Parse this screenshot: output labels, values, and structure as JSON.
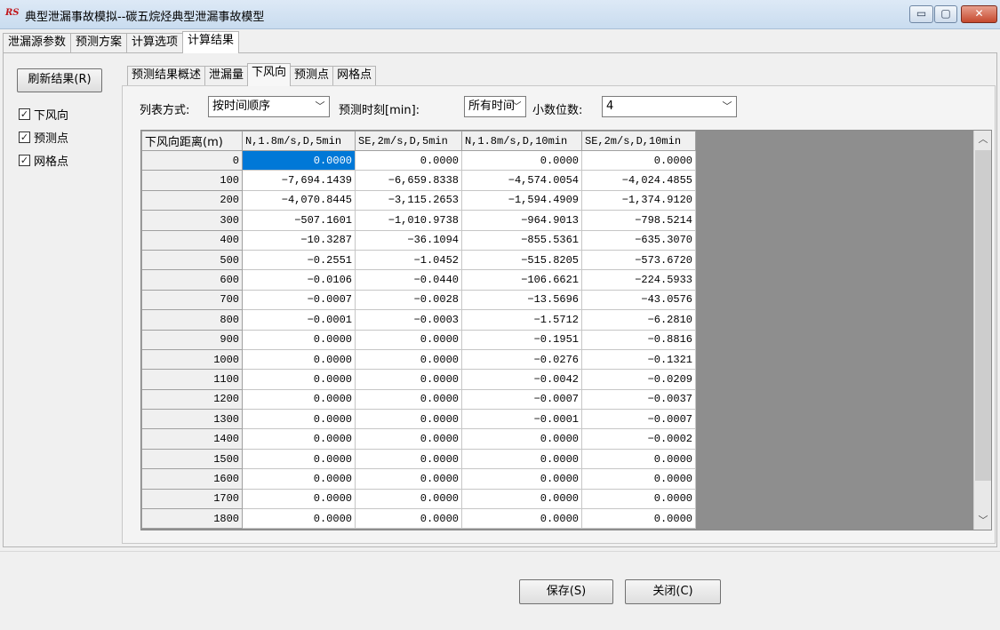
{
  "window": {
    "logo": "RS",
    "title": "典型泄漏事故模拟--碳五烷烃典型泄漏事故模型",
    "min_glyph": "▭",
    "max_glyph": "▢",
    "close_glyph": "✕"
  },
  "main_tabs": [
    "泄漏源参数",
    "预测方案",
    "计算选项",
    "计算结果"
  ],
  "sidebar": {
    "refresh_label": "刷新结果(R)",
    "checks": [
      {
        "label": "下风向",
        "checked": true
      },
      {
        "label": "预测点",
        "checked": true
      },
      {
        "label": "网格点",
        "checked": true
      }
    ]
  },
  "sub_tabs": [
    "预测结果概述",
    "泄漏量",
    "下风向",
    "预测点",
    "网格点"
  ],
  "controls": {
    "list_mode_label": "列表方式:",
    "list_mode_value": "按时间顺序",
    "time_label": "预测时刻[min]:",
    "time_value": "所有时间",
    "decimals_label": "小数位数:",
    "decimals_value": "4"
  },
  "table": {
    "headers": [
      "下风向距离(m)",
      "N,1.8m/s,D,5min",
      "SE,2m/s,D,5min",
      "N,1.8m/s,D,10min",
      "SE,2m/s,D,10min"
    ],
    "rows": [
      [
        "0",
        "0.0000",
        "0.0000",
        "0.0000",
        "0.0000"
      ],
      [
        "100",
        "−7,694.1439",
        "−6,659.8338",
        "−4,574.0054",
        "−4,024.4855"
      ],
      [
        "200",
        "−4,070.8445",
        "−3,115.2653",
        "−1,594.4909",
        "−1,374.9120"
      ],
      [
        "300",
        "−507.1601",
        "−1,010.9738",
        "−964.9013",
        "−798.5214"
      ],
      [
        "400",
        "−10.3287",
        "−36.1094",
        "−855.5361",
        "−635.3070"
      ],
      [
        "500",
        "−0.2551",
        "−1.0452",
        "−515.8205",
        "−573.6720"
      ],
      [
        "600",
        "−0.0106",
        "−0.0440",
        "−106.6621",
        "−224.5933"
      ],
      [
        "700",
        "−0.0007",
        "−0.0028",
        "−13.5696",
        "−43.0576"
      ],
      [
        "800",
        "−0.0001",
        "−0.0003",
        "−1.5712",
        "−6.2810"
      ],
      [
        "900",
        "0.0000",
        "0.0000",
        "−0.1951",
        "−0.8816"
      ],
      [
        "1000",
        "0.0000",
        "0.0000",
        "−0.0276",
        "−0.1321"
      ],
      [
        "1100",
        "0.0000",
        "0.0000",
        "−0.0042",
        "−0.0209"
      ],
      [
        "1200",
        "0.0000",
        "0.0000",
        "−0.0007",
        "−0.0037"
      ],
      [
        "1300",
        "0.0000",
        "0.0000",
        "−0.0001",
        "−0.0007"
      ],
      [
        "1400",
        "0.0000",
        "0.0000",
        "0.0000",
        "−0.0002"
      ],
      [
        "1500",
        "0.0000",
        "0.0000",
        "0.0000",
        "0.0000"
      ],
      [
        "1600",
        "0.0000",
        "0.0000",
        "0.0000",
        "0.0000"
      ],
      [
        "1700",
        "0.0000",
        "0.0000",
        "0.0000",
        "0.0000"
      ],
      [
        "1800",
        "0.0000",
        "0.0000",
        "0.0000",
        "0.0000"
      ]
    ]
  },
  "footer": {
    "save_label": "保存(S)",
    "close_label": "关闭(C)"
  },
  "colors": {
    "selection": "#0078d7",
    "grid_background": "#8e8e8e"
  }
}
